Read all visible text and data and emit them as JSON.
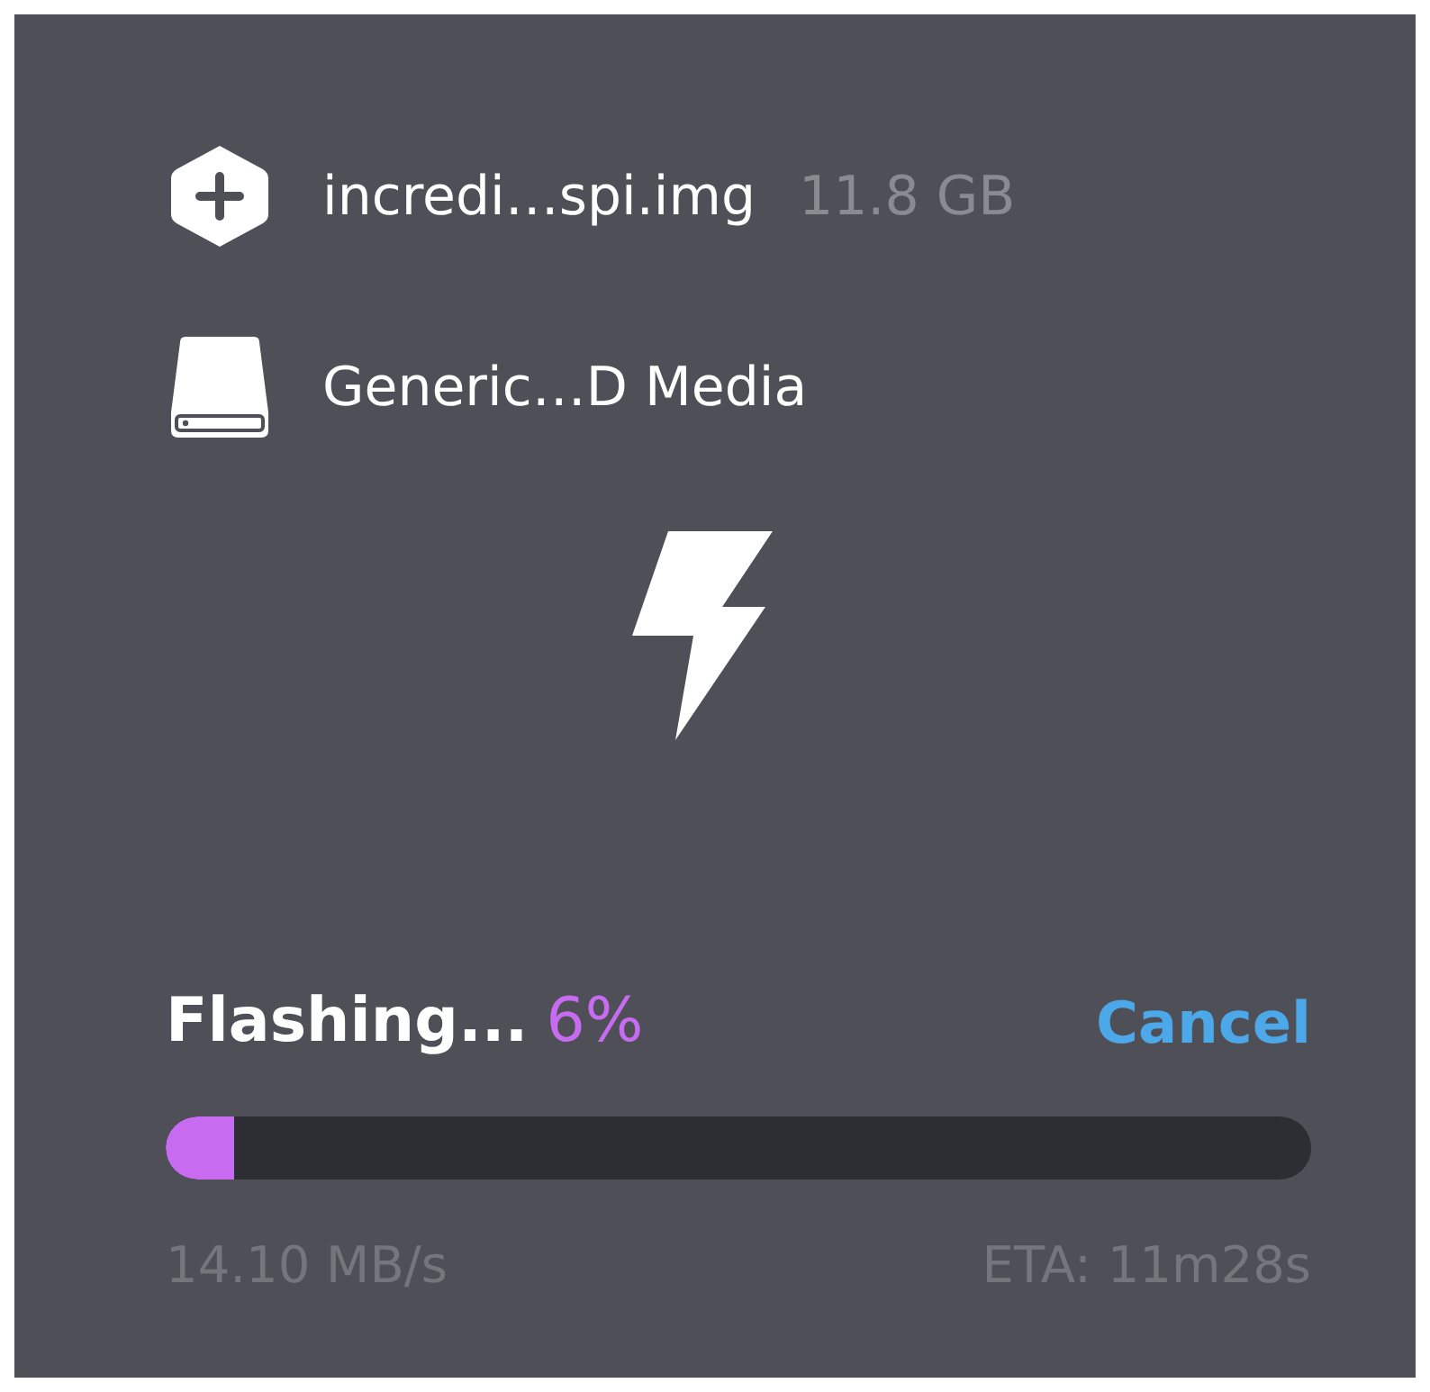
{
  "image": {
    "name": "incredi…spi.img",
    "size": "11.8 GB"
  },
  "drive": {
    "name": "Generic…D Media"
  },
  "progress": {
    "status": "Flashing...",
    "percent": "6%",
    "level": 0.06,
    "cancel": "Cancel",
    "speed": "14.10 MB/s",
    "eta": "ETA: 11m28s"
  }
}
